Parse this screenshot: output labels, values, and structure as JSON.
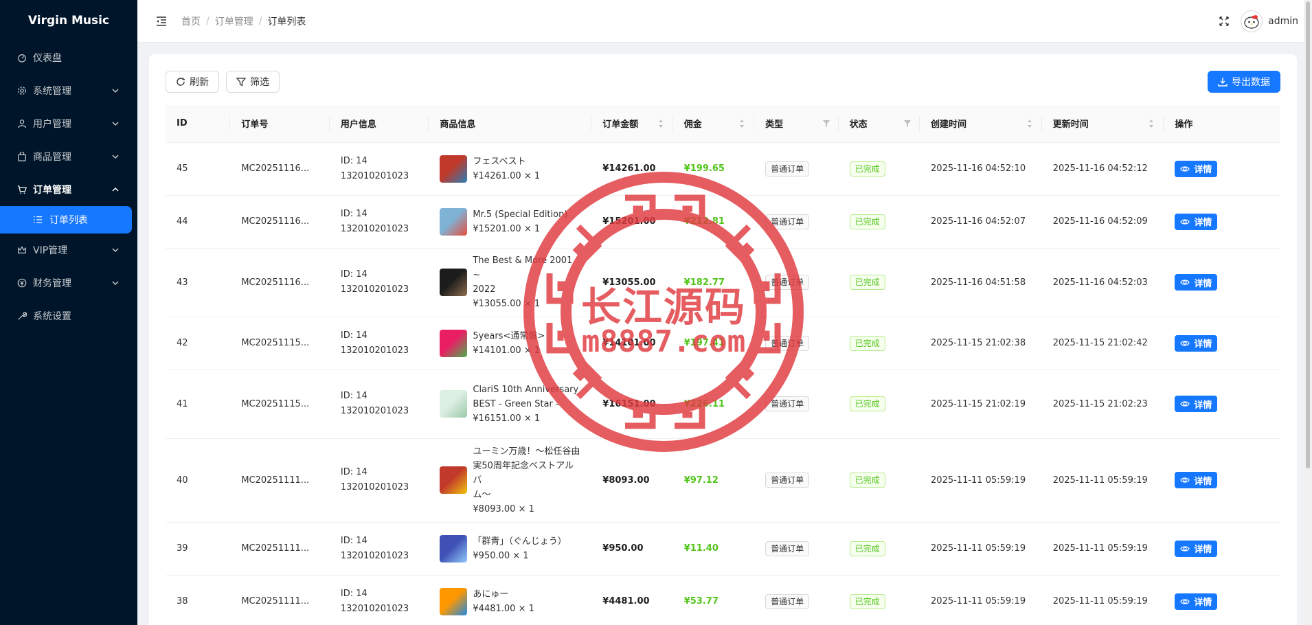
{
  "app": {
    "title": "Virgin Music"
  },
  "sidebar": {
    "items": [
      {
        "label": "仪表盘",
        "icon": "dashboard-icon",
        "has_children": false
      },
      {
        "label": "系统管理",
        "icon": "gear-icon",
        "has_children": true
      },
      {
        "label": "用户管理",
        "icon": "user-icon",
        "has_children": true
      },
      {
        "label": "商品管理",
        "icon": "shopping-bag-icon",
        "has_children": true
      },
      {
        "label": "订单管理",
        "icon": "cart-icon",
        "has_children": true,
        "open": true
      },
      {
        "label": "VIP管理",
        "icon": "crown-icon",
        "has_children": true
      },
      {
        "label": "财务管理",
        "icon": "money-icon",
        "has_children": true
      },
      {
        "label": "系统设置",
        "icon": "wrench-icon",
        "has_children": false
      }
    ],
    "active_subitem": {
      "label": "订单列表",
      "icon": "list-icon"
    }
  },
  "header": {
    "breadcrumb": [
      "首页",
      "订单管理",
      "订单列表"
    ],
    "breadcrumb_separator": "/",
    "username": "admin"
  },
  "toolbar": {
    "refresh_label": "刷新",
    "filter_label": "筛选",
    "export_label": "导出数据"
  },
  "table": {
    "columns": [
      "ID",
      "订单号",
      "用户信息",
      "商品信息",
      "订单金额",
      "佣金",
      "类型",
      "状态",
      "创建时间",
      "更新时间",
      "操作"
    ],
    "detail_label": "详情",
    "rows": [
      {
        "id": "45",
        "order_no": "MC20251116...",
        "user_id": "ID: 14",
        "user_phone": "132010201023",
        "product_lines": [
          "フェスベスト"
        ],
        "product_price": "¥14261.00 × 1",
        "amount": "¥14261.00",
        "commission": "¥199.65",
        "type": "普通订单",
        "status": "已完成",
        "created": "2025-11-16 04:52:10",
        "updated": "2025-11-16 04:52:12",
        "thumb_colors": [
          "#c0392b",
          "#2980b9"
        ]
      },
      {
        "id": "44",
        "order_no": "MC20251116...",
        "user_id": "ID: 14",
        "user_phone": "132010201023",
        "product_lines": [
          "Mr.5 (Special Edition)"
        ],
        "product_price": "¥15201.00 × 1",
        "amount": "¥15201.00",
        "commission": "¥212.81",
        "type": "普通订单",
        "status": "已完成",
        "created": "2025-11-16 04:52:07",
        "updated": "2025-11-16 04:52:09",
        "thumb_colors": [
          "#7fb3d5",
          "#e74c3c"
        ]
      },
      {
        "id": "43",
        "order_no": "MC20251116...",
        "user_id": "ID: 14",
        "user_phone": "132010201023",
        "product_lines": [
          "The Best & More 2001 ~",
          "2022"
        ],
        "product_price": "¥13055.00 × 1",
        "amount": "¥13055.00",
        "commission": "¥182.77",
        "type": "普通订单",
        "status": "已完成",
        "created": "2025-11-16 04:51:58",
        "updated": "2025-11-16 04:52:03",
        "thumb_colors": [
          "#1c1c1c",
          "#8e6e4e"
        ]
      },
      {
        "id": "42",
        "order_no": "MC20251115...",
        "user_id": "ID: 14",
        "user_phone": "132010201023",
        "product_lines": [
          "5years<通常盤>"
        ],
        "product_price": "¥14101.00 × 1",
        "amount": "¥14101.00",
        "commission": "¥197.41",
        "type": "普通订单",
        "status": "已完成",
        "created": "2025-11-15 21:02:38",
        "updated": "2025-11-15 21:02:42",
        "thumb_colors": [
          "#e91e63",
          "#4caf50"
        ]
      },
      {
        "id": "41",
        "order_no": "MC20251115...",
        "user_id": "ID: 14",
        "user_phone": "132010201023",
        "product_lines": [
          "ClariS 10th Anniversary",
          "BEST - Green Star -"
        ],
        "product_price": "¥16151.00 × 1",
        "amount": "¥16151.00",
        "commission": "¥226.11",
        "type": "普通订单",
        "status": "已完成",
        "created": "2025-11-15 21:02:19",
        "updated": "2025-11-15 21:02:23",
        "thumb_colors": [
          "#dcefe3",
          "#9bc9a8"
        ]
      },
      {
        "id": "40",
        "order_no": "MC20251111...",
        "user_id": "ID: 14",
        "user_phone": "132010201023",
        "product_lines": [
          "ユーミン万歳！～松任谷由",
          "実50周年記念ベストアルバ",
          "ム～"
        ],
        "product_price": "¥8093.00 × 1",
        "amount": "¥8093.00",
        "commission": "¥97.12",
        "type": "普通订单",
        "status": "已完成",
        "created": "2025-11-11 05:59:19",
        "updated": "2025-11-11 05:59:19",
        "thumb_colors": [
          "#c0392b",
          "#f1c40f"
        ]
      },
      {
        "id": "39",
        "order_no": "MC20251111...",
        "user_id": "ID: 14",
        "user_phone": "132010201023",
        "product_lines": [
          "「群青」（ぐんじょう）"
        ],
        "product_price": "¥950.00 × 1",
        "amount": "¥950.00",
        "commission": "¥11.40",
        "type": "普通订单",
        "status": "已完成",
        "created": "2025-11-11 05:59:19",
        "updated": "2025-11-11 05:59:19",
        "thumb_colors": [
          "#3f51b5",
          "#90caf9"
        ]
      },
      {
        "id": "38",
        "order_no": "MC20251111...",
        "user_id": "ID: 14",
        "user_phone": "132010201023",
        "product_lines": [
          "あにゅー"
        ],
        "product_price": "¥4481.00 × 1",
        "amount": "¥4481.00",
        "commission": "¥53.77",
        "type": "普通订单",
        "status": "已完成",
        "created": "2025-11-11 05:59:19",
        "updated": "2025-11-11 05:59:19",
        "thumb_colors": [
          "#ff9800",
          "#1e88e5"
        ]
      }
    ]
  },
  "watermark": {
    "line1": "长江源码",
    "line2": "m8887.com",
    "color": "#e03a3f"
  },
  "colors": {
    "sidebar_bg": "#001529",
    "primary": "#1677ff",
    "success": "#52c41a"
  }
}
